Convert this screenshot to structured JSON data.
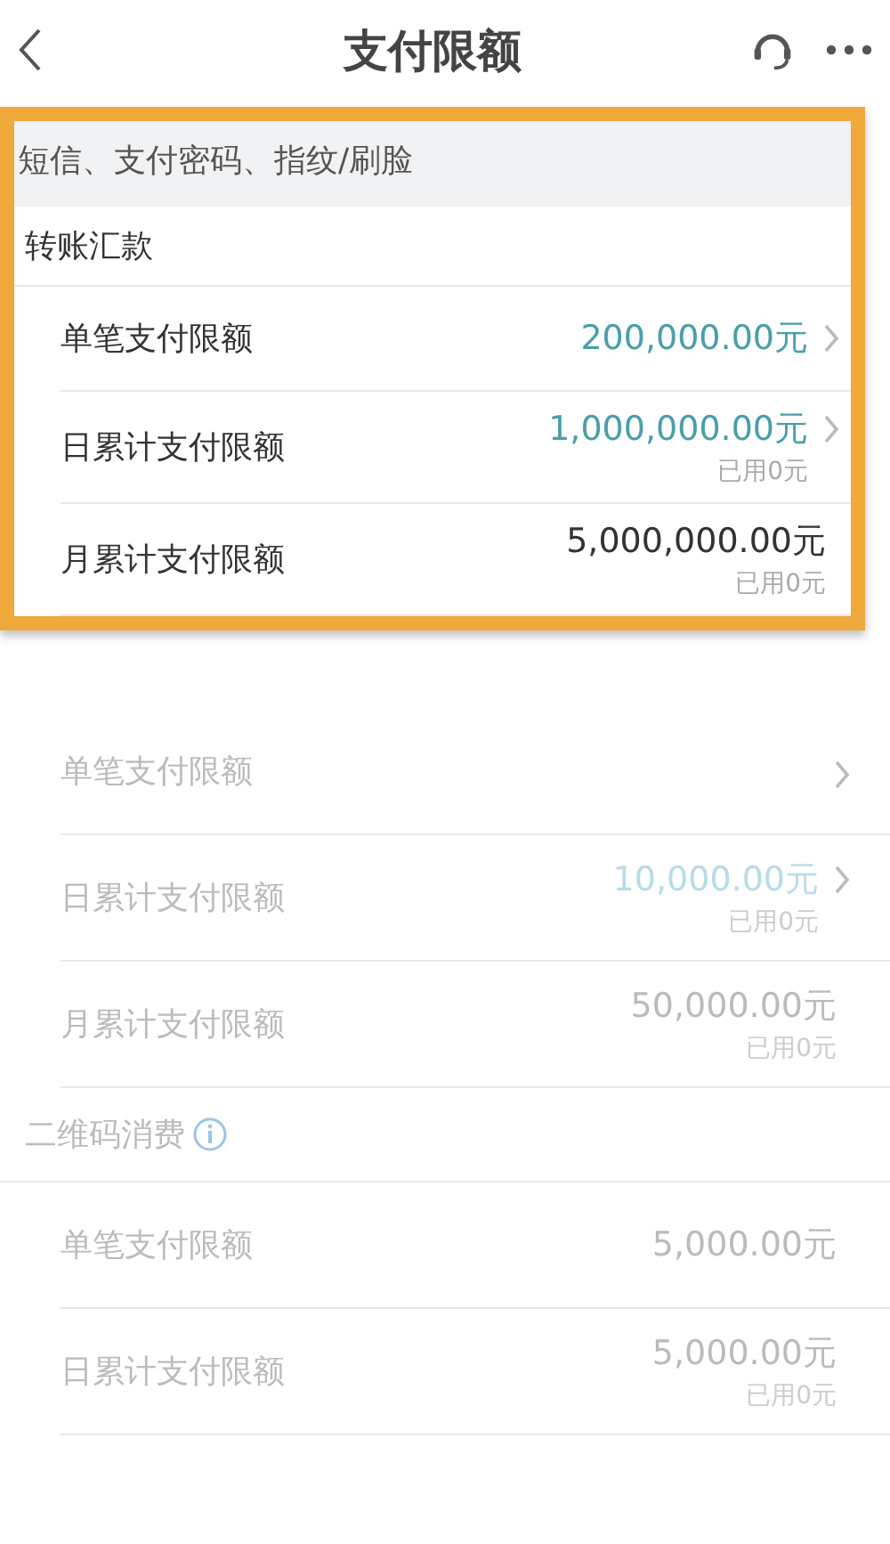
{
  "header": {
    "title": "支付限额"
  },
  "auth_note": "短信、支付密码、指纹/刷脸",
  "sections": [
    {
      "title": "转账汇款",
      "highlighted": true,
      "info": false,
      "rows": [
        {
          "label": "单笔支付限额",
          "value": "200,000.00元",
          "editable": true
        },
        {
          "label": "日累计支付限额",
          "value": "1,000,000.00元",
          "used": "已用0元",
          "editable": true
        },
        {
          "label": "月累计支付限额",
          "value": "5,000,000.00元",
          "used": "已用0元",
          "editable": false
        }
      ]
    },
    {
      "highlighted": false,
      "rows": [
        {
          "label": "单笔支付限额",
          "editable": true
        },
        {
          "label": "日累计支付限额",
          "value": "10,000.00元",
          "used": "已用0元",
          "editable": true
        },
        {
          "label": "月累计支付限额",
          "value": "50,000.00元",
          "used": "已用0元",
          "editable": false
        }
      ]
    },
    {
      "title": "二维码消费",
      "highlighted": false,
      "info": true,
      "rows": [
        {
          "label": "单笔支付限额",
          "value": "5,000.00元",
          "editable": false
        },
        {
          "label": "日累计支付限额",
          "value": "5,000.00元",
          "used": "已用0元",
          "editable": false
        }
      ]
    }
  ]
}
